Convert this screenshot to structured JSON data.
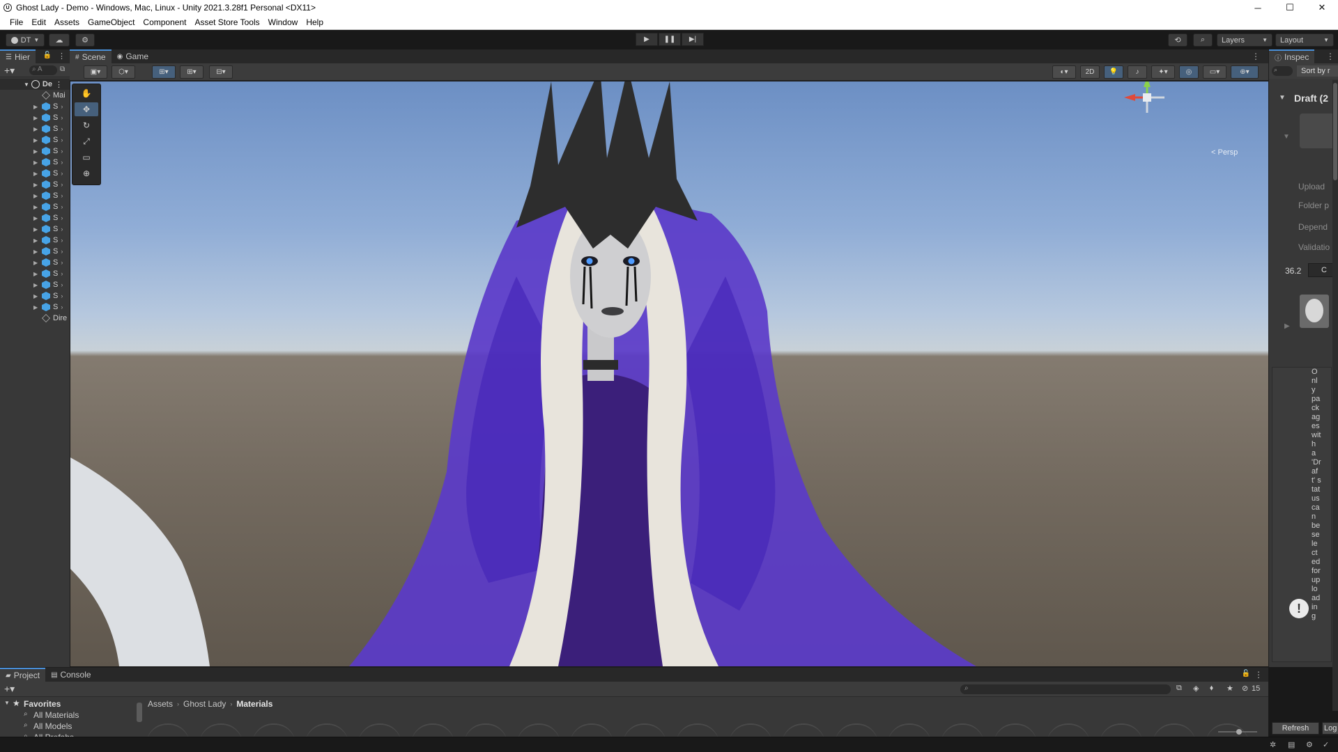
{
  "window": {
    "title": "Ghost Lady - Demo - Windows, Mac, Linux - Unity 2021.3.28f1 Personal <DX11>",
    "controls": [
      "─",
      "☐",
      "✕"
    ]
  },
  "menu": [
    "File",
    "Edit",
    "Assets",
    "GameObject",
    "Component",
    "Asset Store Tools",
    "Window",
    "Help"
  ],
  "toolbar": {
    "account_label": "DT",
    "layers_label": "Layers",
    "layout_label": "Layout"
  },
  "hierarchy": {
    "tab_label": "Hier",
    "search_placeholder": "A",
    "scene_name": "De",
    "rows": [
      {
        "label": "Mai",
        "icon": "grey"
      },
      {
        "label": "S",
        "icon": "blue"
      },
      {
        "label": "S",
        "icon": "blue"
      },
      {
        "label": "S",
        "icon": "blue"
      },
      {
        "label": "S",
        "icon": "blue"
      },
      {
        "label": "S",
        "icon": "blue"
      },
      {
        "label": "S",
        "icon": "blue"
      },
      {
        "label": "S",
        "icon": "blue"
      },
      {
        "label": "S",
        "icon": "blue"
      },
      {
        "label": "S",
        "icon": "blue"
      },
      {
        "label": "S",
        "icon": "blue"
      },
      {
        "label": "S",
        "icon": "blue"
      },
      {
        "label": "S",
        "icon": "blue"
      },
      {
        "label": "S",
        "icon": "blue"
      },
      {
        "label": "S",
        "icon": "blue"
      },
      {
        "label": "S",
        "icon": "blue"
      },
      {
        "label": "S",
        "icon": "blue"
      },
      {
        "label": "S",
        "icon": "blue"
      },
      {
        "label": "S",
        "icon": "blue"
      },
      {
        "label": "S",
        "icon": "blue"
      },
      {
        "label": "Dire",
        "icon": "grey"
      }
    ]
  },
  "scene": {
    "tabs": [
      "Scene",
      "Game"
    ],
    "mode_2d": "2D",
    "gizmo_label": "< Persp"
  },
  "inspector": {
    "tab_label": "Inspec",
    "sort_label": "Sort by r",
    "title": "Draft (2",
    "fields": [
      "Upload",
      "Folder p",
      "Depend",
      "Validatio"
    ],
    "value": "36.2",
    "value_btn": "C",
    "message": "Only packages with a 'Draft' status can be selected for uploading",
    "refresh_label": "Refresh",
    "log_label": "Log"
  },
  "project": {
    "tabs": [
      "Project",
      "Console"
    ],
    "favorites_label": "Favorites",
    "favorites": [
      "All Materials",
      "All Models",
      "All Prefabs"
    ],
    "breadcrumb": [
      "Assets",
      "Ghost Lady",
      "Materials"
    ],
    "hidden_count": "15"
  },
  "colors": {
    "accent": "#4a90d9",
    "veil": "#5b3bc9",
    "hair": "#e8e4dc",
    "crown": "#2d2d2d"
  }
}
